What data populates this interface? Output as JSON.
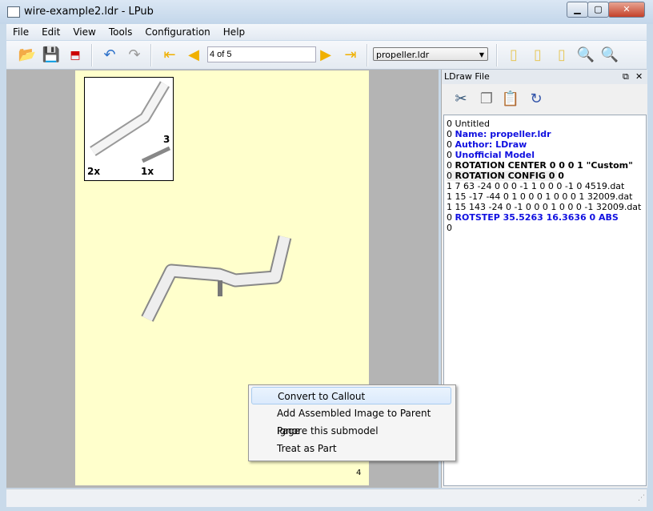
{
  "window": {
    "title": "wire-example2.ldr - LPub",
    "controls": [
      "minimize",
      "maximize",
      "close"
    ]
  },
  "menu": [
    "File",
    "Edit",
    "View",
    "Tools",
    "Configuration",
    "Help"
  ],
  "toolbar": {
    "page_field": "4 of 5",
    "submodel_select": "propeller.ldr"
  },
  "page": {
    "pli_counts": {
      "part1": "2x",
      "part2": "1x",
      "length": "3"
    },
    "page_number": "4"
  },
  "dock": {
    "title": "LDraw File",
    "lines": [
      {
        "text": "0 Untitled",
        "style": "plain"
      },
      {
        "prefix": "0 ",
        "text": "Name: propeller.ldr",
        "style": "blue"
      },
      {
        "prefix": "0 ",
        "text": "Author: LDraw",
        "style": "blue"
      },
      {
        "prefix": "0 ",
        "text": "Unofficial Model",
        "style": "blue"
      },
      {
        "prefix": "0 ",
        "text": "ROTATION CENTER 0 0 0 1 \"Custom\"",
        "style": "bold"
      },
      {
        "prefix": "0 ",
        "text": "ROTATION CONFIG 0 0",
        "style": "bold"
      },
      {
        "text": "1 7 63 -24 0 0 0 -1 1 0 0 0 -1 0 4519.dat",
        "style": "plain"
      },
      {
        "text": "1 15 -17 -44 0 1 0 0 0 1 0 0 0 1 32009.dat",
        "style": "plain"
      },
      {
        "text": "1 15 143 -24 0 -1 0 0 0 1 0 0 0 -1 32009.dat",
        "style": "plain"
      },
      {
        "prefix": "0 ",
        "text": "ROTSTEP 35.5263 16.3636 0 ABS",
        "style": "blue"
      },
      {
        "text": "0",
        "style": "plain"
      }
    ]
  },
  "context_menu": [
    "Convert to Callout",
    "Add Assembled Image to Parent Page",
    "Ignore this submodel",
    "Treat as Part"
  ]
}
